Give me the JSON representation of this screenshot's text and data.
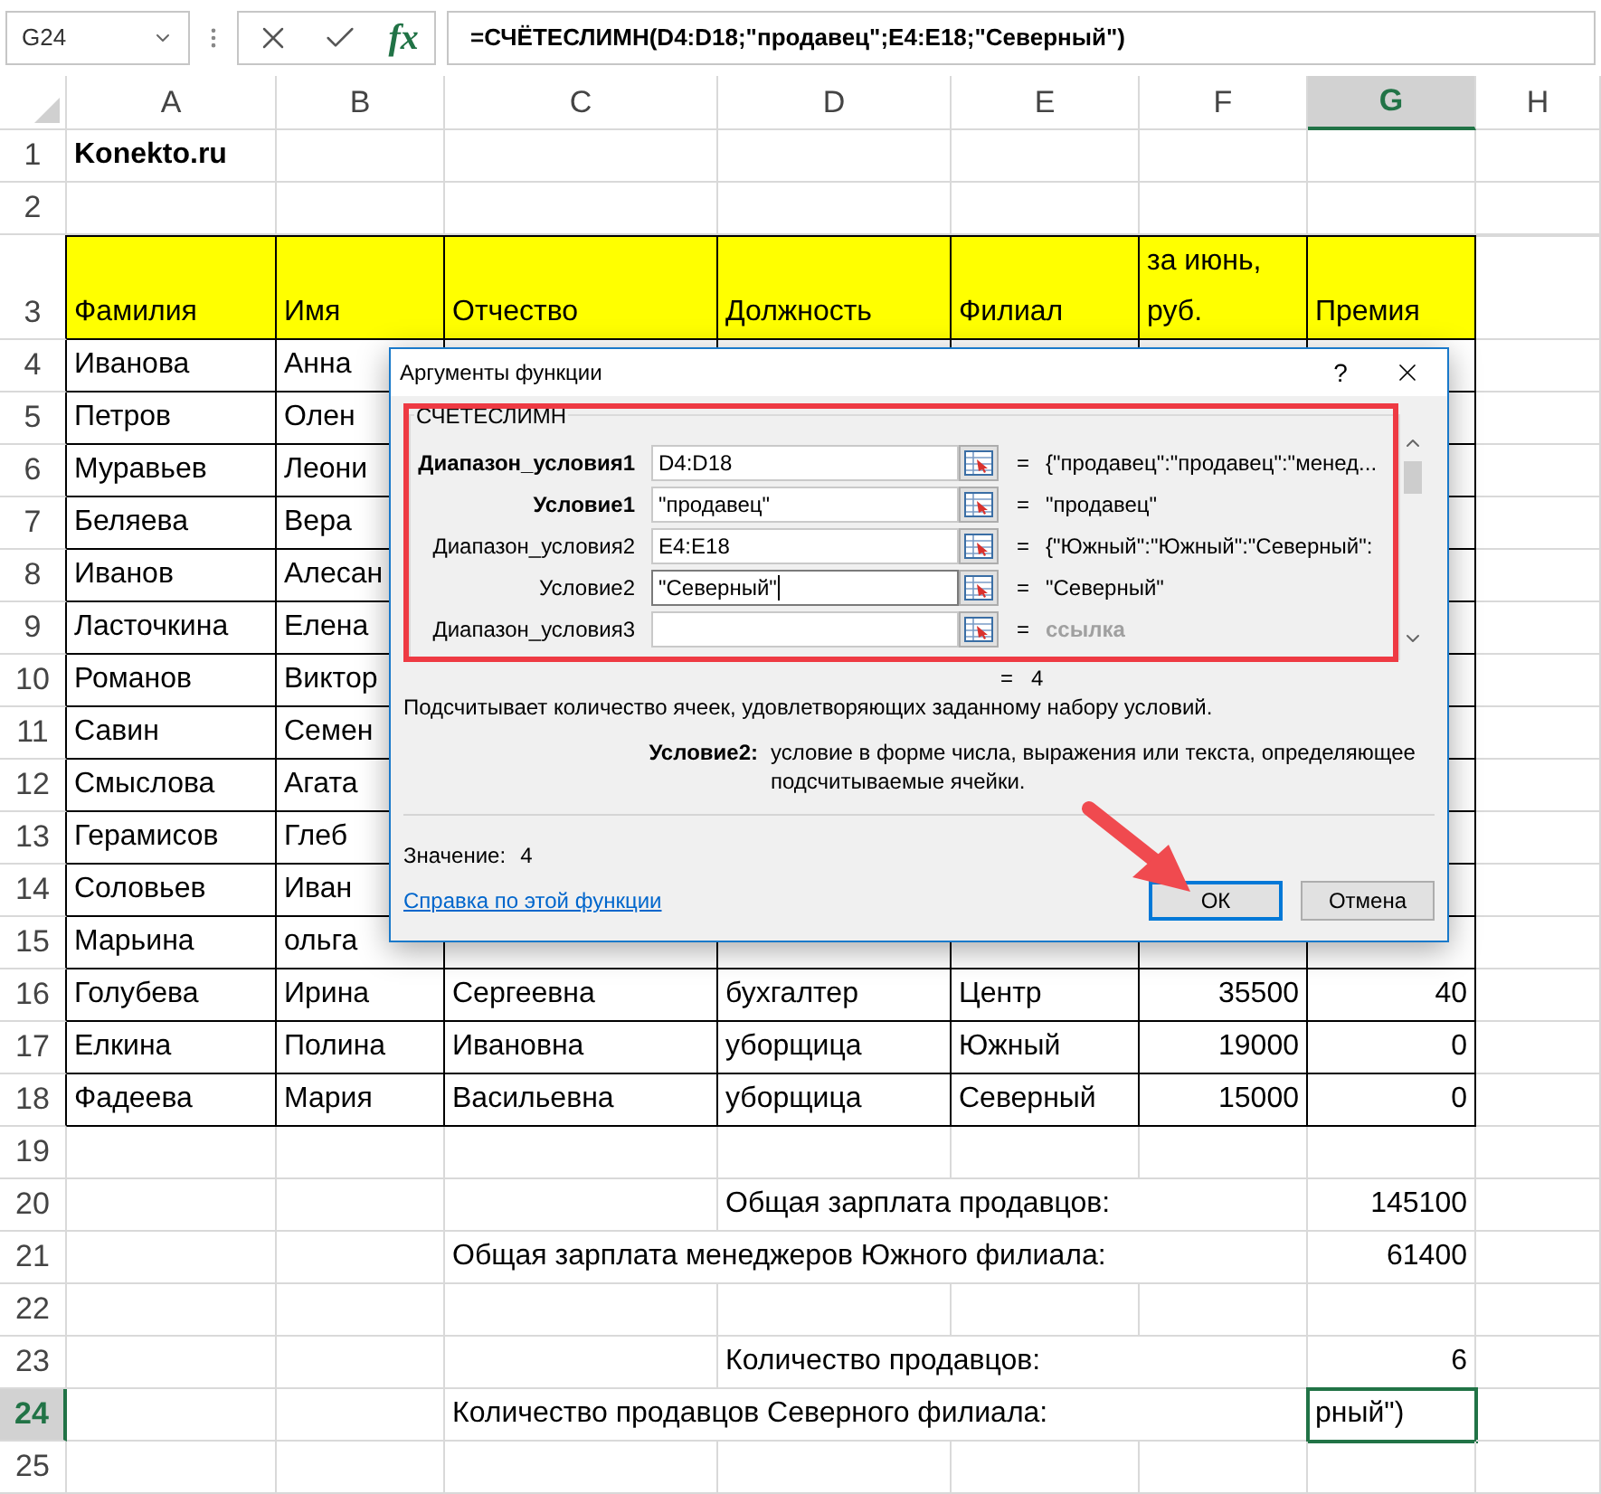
{
  "formula_bar": {
    "name_box": "G24",
    "fx_label": "fx",
    "formula": "=СЧЁТЕСЛИМН(D4:D18;\"продавец\";E4:E18;\"Северный\")"
  },
  "columns": [
    {
      "label": "A",
      "selected": false
    },
    {
      "label": "B",
      "selected": false
    },
    {
      "label": "C",
      "selected": false
    },
    {
      "label": "D",
      "selected": false
    },
    {
      "label": "E",
      "selected": false
    },
    {
      "label": "F",
      "selected": false
    },
    {
      "label": "G",
      "selected": true
    },
    {
      "label": "H",
      "selected": false
    }
  ],
  "rows": [
    {
      "number": "1",
      "selected": false,
      "highlighted": false,
      "bordered": false,
      "cells": {
        "a": {
          "text": "Konekto.ru",
          "kind": "text",
          "bold": true
        }
      }
    },
    {
      "number": "2",
      "selected": false,
      "highlighted": false,
      "bordered": false,
      "cells": {}
    },
    {
      "number": "3",
      "selected": false,
      "highlighted": true,
      "bordered": true,
      "cells": {
        "a": {
          "text": "Фамилия",
          "kind": "text",
          "bold": false
        },
        "b": {
          "text": "Имя",
          "kind": "text",
          "bold": false
        },
        "c": {
          "text": "Отчество",
          "kind": "text",
          "bold": false
        },
        "d": {
          "text": "Должность",
          "kind": "text",
          "bold": false
        },
        "e": {
          "text": "Филиал",
          "kind": "text",
          "bold": false
        },
        "f": {
          "text": "за июнь, руб.",
          "kind": "text",
          "bold": false
        },
        "g": {
          "text": "Премия",
          "kind": "text",
          "bold": false
        }
      }
    },
    {
      "number": "4",
      "selected": false,
      "highlighted": false,
      "bordered": true,
      "cells": {
        "a": {
          "text": "Иванова",
          "kind": "text",
          "bold": false
        },
        "b": {
          "text": "Анна",
          "kind": "text",
          "bold": false
        }
      }
    },
    {
      "number": "5",
      "selected": false,
      "highlighted": false,
      "bordered": true,
      "cells": {
        "a": {
          "text": "Петров",
          "kind": "text",
          "bold": false
        },
        "b": {
          "text": "Олен",
          "kind": "text",
          "bold": false
        }
      }
    },
    {
      "number": "6",
      "selected": false,
      "highlighted": false,
      "bordered": true,
      "cells": {
        "a": {
          "text": "Муравьев",
          "kind": "text",
          "bold": false
        },
        "b": {
          "text": "Леони",
          "kind": "text",
          "bold": false
        }
      }
    },
    {
      "number": "7",
      "selected": false,
      "highlighted": false,
      "bordered": true,
      "cells": {
        "a": {
          "text": "Беляева",
          "kind": "text",
          "bold": false
        },
        "b": {
          "text": "Вера",
          "kind": "text",
          "bold": false
        }
      }
    },
    {
      "number": "8",
      "selected": false,
      "highlighted": false,
      "bordered": true,
      "cells": {
        "a": {
          "text": "Иванов",
          "kind": "text",
          "bold": false
        },
        "b": {
          "text": "Алесан",
          "kind": "text",
          "bold": false
        }
      }
    },
    {
      "number": "9",
      "selected": false,
      "highlighted": false,
      "bordered": true,
      "cells": {
        "a": {
          "text": "Ласточкина",
          "kind": "text",
          "bold": false
        },
        "b": {
          "text": "Елена",
          "kind": "text",
          "bold": false
        }
      }
    },
    {
      "number": "10",
      "selected": false,
      "highlighted": false,
      "bordered": true,
      "cells": {
        "a": {
          "text": "Романов",
          "kind": "text",
          "bold": false
        },
        "b": {
          "text": "Виктор",
          "kind": "text",
          "bold": false
        }
      }
    },
    {
      "number": "11",
      "selected": false,
      "highlighted": false,
      "bordered": true,
      "cells": {
        "a": {
          "text": "Савин",
          "kind": "text",
          "bold": false
        },
        "b": {
          "text": "Семен",
          "kind": "text",
          "bold": false
        }
      }
    },
    {
      "number": "12",
      "selected": false,
      "highlighted": false,
      "bordered": true,
      "cells": {
        "a": {
          "text": "Смыслова",
          "kind": "text",
          "bold": false
        },
        "b": {
          "text": "Агата",
          "kind": "text",
          "bold": false
        }
      }
    },
    {
      "number": "13",
      "selected": false,
      "highlighted": false,
      "bordered": true,
      "cells": {
        "a": {
          "text": "Герамисов",
          "kind": "text",
          "bold": false
        },
        "b": {
          "text": "Глеб",
          "kind": "text",
          "bold": false
        }
      }
    },
    {
      "number": "14",
      "selected": false,
      "highlighted": false,
      "bordered": true,
      "cells": {
        "a": {
          "text": "Соловьев",
          "kind": "text",
          "bold": false
        },
        "b": {
          "text": "Иван",
          "kind": "text",
          "bold": false
        }
      }
    },
    {
      "number": "15",
      "selected": false,
      "highlighted": false,
      "bordered": true,
      "cells": {
        "a": {
          "text": "Марьина",
          "kind": "text",
          "bold": false
        },
        "b": {
          "text": "ольга",
          "kind": "text",
          "bold": false
        }
      }
    },
    {
      "number": "16",
      "selected": false,
      "highlighted": false,
      "bordered": true,
      "cells": {
        "a": {
          "text": "Голубева",
          "kind": "text",
          "bold": false
        },
        "b": {
          "text": "Ирина",
          "kind": "text",
          "bold": false
        },
        "c": {
          "text": "Сергеевна",
          "kind": "text",
          "bold": false
        },
        "d": {
          "text": "бухгалтер",
          "kind": "text",
          "bold": false
        },
        "e": {
          "text": "Центр",
          "kind": "text",
          "bold": false
        },
        "f": {
          "text": "35500",
          "kind": "number",
          "bold": false
        },
        "g": {
          "text": "40",
          "kind": "number",
          "bold": false
        }
      }
    },
    {
      "number": "17",
      "selected": false,
      "highlighted": false,
      "bordered": true,
      "cells": {
        "a": {
          "text": "Елкина",
          "kind": "text",
          "bold": false
        },
        "b": {
          "text": "Полина",
          "kind": "text",
          "bold": false
        },
        "c": {
          "text": "Ивановна",
          "kind": "text",
          "bold": false
        },
        "d": {
          "text": "уборщица",
          "kind": "text",
          "bold": false
        },
        "e": {
          "text": "Южный",
          "kind": "text",
          "bold": false
        },
        "f": {
          "text": "19000",
          "kind": "number",
          "bold": false
        },
        "g": {
          "text": "0",
          "kind": "number",
          "bold": false
        }
      }
    },
    {
      "number": "18",
      "selected": false,
      "highlighted": false,
      "bordered": true,
      "cells": {
        "a": {
          "text": "Фадеева",
          "kind": "text",
          "bold": false
        },
        "b": {
          "text": "Мария",
          "kind": "text",
          "bold": false
        },
        "c": {
          "text": "Васильевна",
          "kind": "text",
          "bold": false
        },
        "d": {
          "text": "уборщица",
          "kind": "text",
          "bold": false
        },
        "e": {
          "text": "Северный",
          "kind": "text",
          "bold": false
        },
        "f": {
          "text": "15000",
          "kind": "number",
          "bold": false
        },
        "g": {
          "text": "0",
          "kind": "number",
          "bold": false
        }
      }
    },
    {
      "number": "19",
      "selected": false,
      "highlighted": false,
      "bordered": false,
      "cells": {}
    },
    {
      "number": "20",
      "selected": false,
      "highlighted": false,
      "bordered": false,
      "cells": {
        "d": {
          "text": "Общая зарплата продавцов:",
          "kind": "text",
          "spills": true,
          "bold": false
        },
        "g": {
          "text": "145100",
          "kind": "number",
          "bold": false
        }
      }
    },
    {
      "number": "21",
      "selected": false,
      "highlighted": false,
      "bordered": false,
      "cells": {
        "c": {
          "text": "Общая зарплата менеджеров Южного филиала:",
          "kind": "text",
          "spills": true,
          "bold": false
        },
        "g": {
          "text": "61400",
          "kind": "number",
          "bold": false
        }
      }
    },
    {
      "number": "22",
      "selected": false,
      "highlighted": false,
      "bordered": false,
      "cells": {}
    },
    {
      "number": "23",
      "selected": false,
      "highlighted": false,
      "bordered": false,
      "cells": {
        "d": {
          "text": "Количество продавцов:",
          "kind": "text",
          "spills": true,
          "bold": false
        },
        "g": {
          "text": "6",
          "kind": "number",
          "bold": false
        }
      }
    },
    {
      "number": "24",
      "selected": true,
      "highlighted": false,
      "bordered": false,
      "cells": {
        "c": {
          "text": "Количество продавцов Северного филиала:",
          "kind": "text",
          "spills": true,
          "bold": false
        },
        "g": {
          "text": "рный\")",
          "kind": "text",
          "bold": false
        }
      }
    },
    {
      "number": "25",
      "selected": false,
      "highlighted": false,
      "bordered": false,
      "cells": {}
    }
  ],
  "dialog": {
    "title": "Аргументы функции",
    "help_button": "?",
    "function_name": "СЧЁТЕСЛИМН",
    "arguments": [
      {
        "label": "Диапазон_условия1",
        "bold": true,
        "value": "D4:D18",
        "focused": false,
        "result": "{\"продавец\":\"продавец\":\"менед...",
        "muted": false
      },
      {
        "label": "Условие1",
        "bold": true,
        "value": "\"продавец\"",
        "focused": false,
        "result": "\"продавец\"",
        "muted": false
      },
      {
        "label": "Диапазон_условия2",
        "bold": false,
        "value": "E4:E18",
        "focused": false,
        "result": "{\"Южный\":\"Южный\":\"Северный\":",
        "muted": false
      },
      {
        "label": "Условие2",
        "bold": false,
        "value": "\"Северный\"",
        "focused": true,
        "result": "\"Северный\"",
        "muted": false
      },
      {
        "label": "Диапазон_условия3",
        "bold": false,
        "focused": false,
        "result": "ссылка",
        "muted": true
      }
    ],
    "equals": "=",
    "total_result": "4",
    "description": "Подсчитывает количество ячеек, удовлетворяющих заданному набору условий.",
    "argument_help": {
      "label": "Условие2:",
      "text": "условие в форме числа, выражения или текста, определяющее подсчитываемые ячейки."
    },
    "value_label": "Значение:",
    "value": "4",
    "help_link": "Справка по этой функции",
    "buttons": [
      {
        "label": "ОК",
        "default": true
      },
      {
        "label": "Отмена",
        "default": false
      }
    ]
  }
}
